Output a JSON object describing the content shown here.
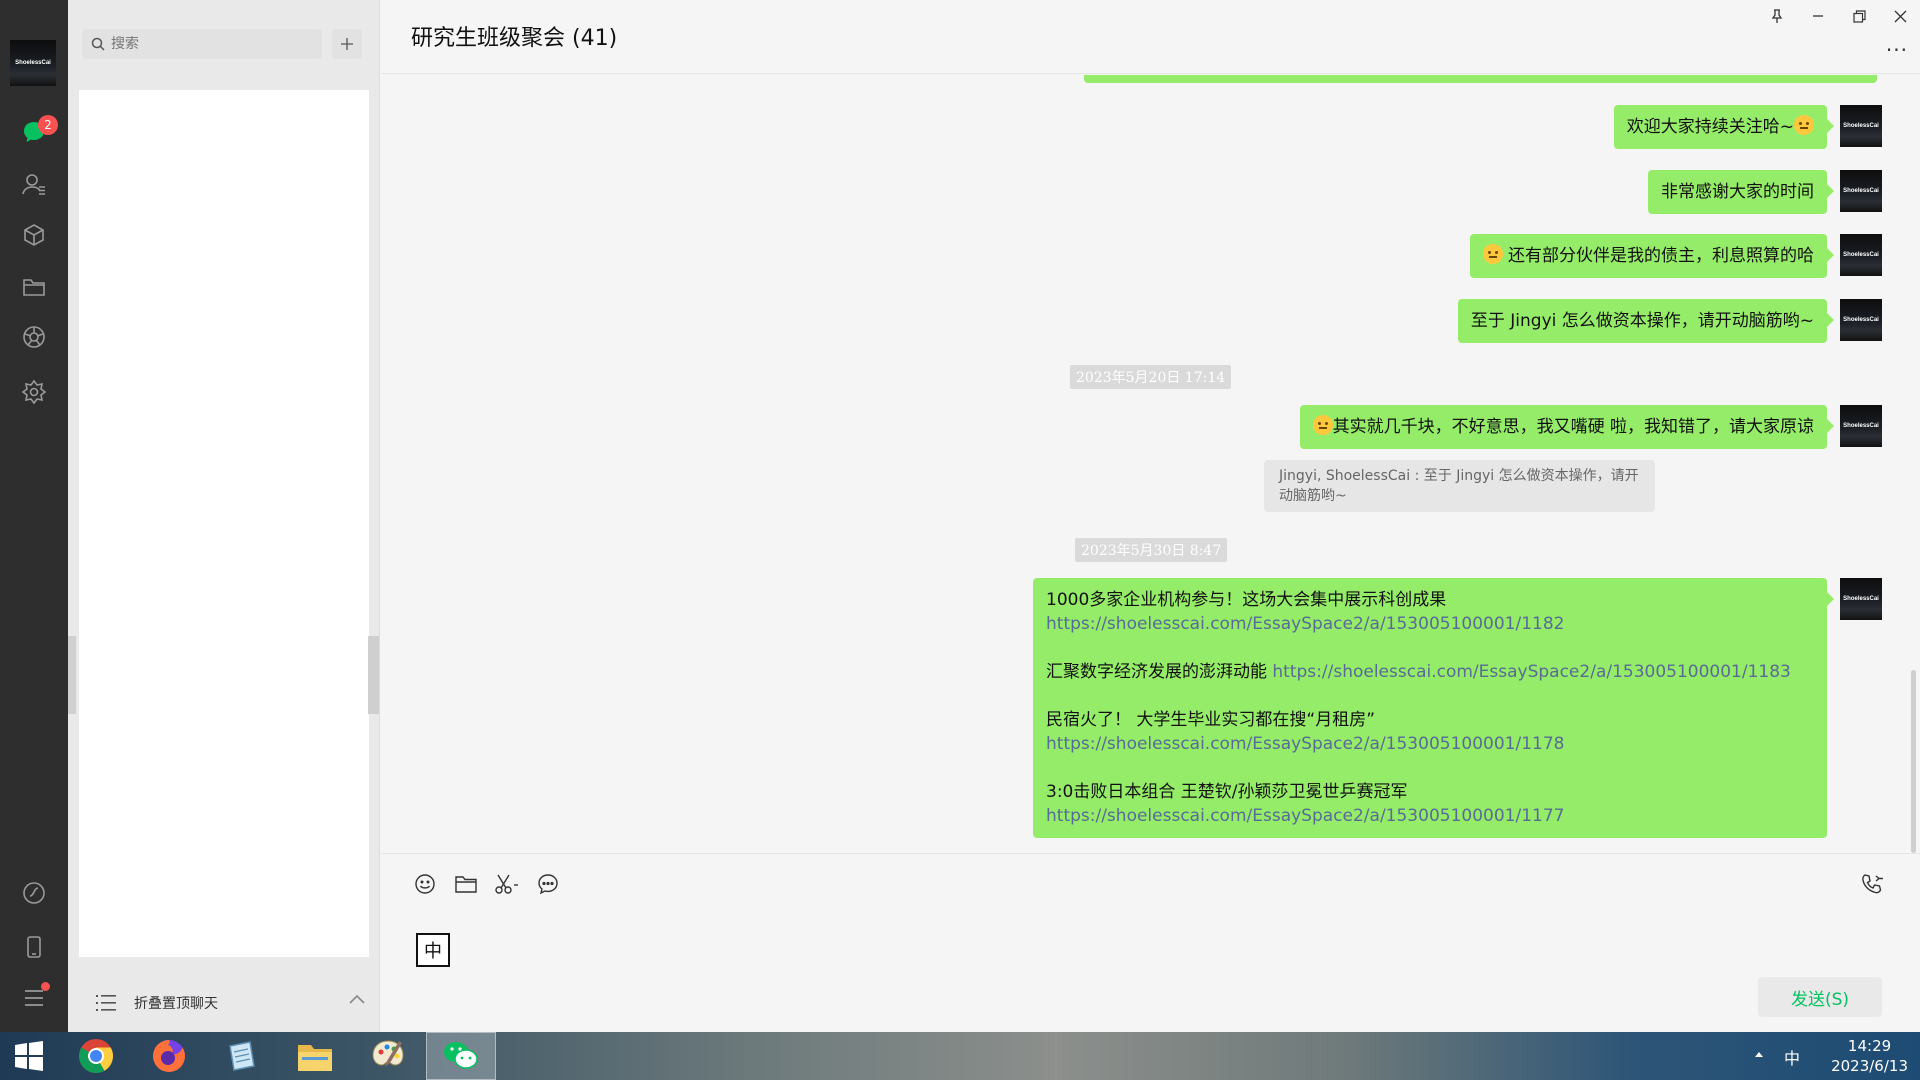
{
  "app": {
    "self_avatar_text": "ShoelessCai",
    "unread_count": "2"
  },
  "search": {
    "placeholder": "搜索"
  },
  "list_footer": {
    "label": "折叠置顶聊天"
  },
  "chat": {
    "title": "研究生班级聚会 (41)",
    "more": "···"
  },
  "messages": [
    {
      "text": "欢迎大家持续关注哈~",
      "emoji": "smile"
    },
    {
      "text": "非常感谢大家的时间"
    },
    {
      "text": " 还有部分伙伴是我的债主，利息照算的哈",
      "emoji": "thinking"
    },
    {
      "text": "至于 Jingyi 怎么做资本操作，请开动脑筋哟~"
    }
  ],
  "timestamps": [
    "2023年5月20日 17:14",
    "2023年5月30日 8:47"
  ],
  "message_5": {
    "text": "其实就几千块，不好意思，我又嘴硬 啦，我知错了，请大家原谅",
    "emoji": "upside-down"
  },
  "quote": {
    "text": "Jingyi, ShoelessCai : 至于 Jingyi 怎么做资本操作，请开动脑筋哟~"
  },
  "message_6": {
    "paragraphs": [
      {
        "text": "1000多家企业机构参与！这场大会集中展示科创成果 ",
        "link": "https://shoelesscai.com/EssaySpace2/a/153005100001/1182"
      },
      {
        "text": "汇聚数字经济发展的澎湃动能 ",
        "link": "https://shoelesscai.com/EssaySpace2/a/153005100001/1183"
      },
      {
        "text": "民宿火了！ 大学生毕业实习都在搜“月租房” ",
        "link": "https://shoelesscai.com/EssaySpace2/a/153005100001/1178"
      },
      {
        "text": "3:0击败日本组合 王楚钦/孙颖莎卫冕世乒赛冠军 ",
        "link": "https://shoelesscai.com/EssaySpace2/a/153005100001/1177"
      }
    ]
  },
  "composer": {
    "ime": "中",
    "send_label": "发送(S)"
  },
  "taskbar": {
    "apps": [
      "start-icon",
      "chrome-icon",
      "firefox-icon",
      "notepad-icon",
      "file-explorer-icon",
      "paint-icon",
      "wechat-icon"
    ],
    "ime": "中",
    "time": "14:29",
    "date": "2023/6/13"
  },
  "colors": {
    "bubble": "#95ec69",
    "nav_bg": "#2e2e2e",
    "accent": "#07c160",
    "link": "#576b95",
    "badge": "#fa5151"
  }
}
